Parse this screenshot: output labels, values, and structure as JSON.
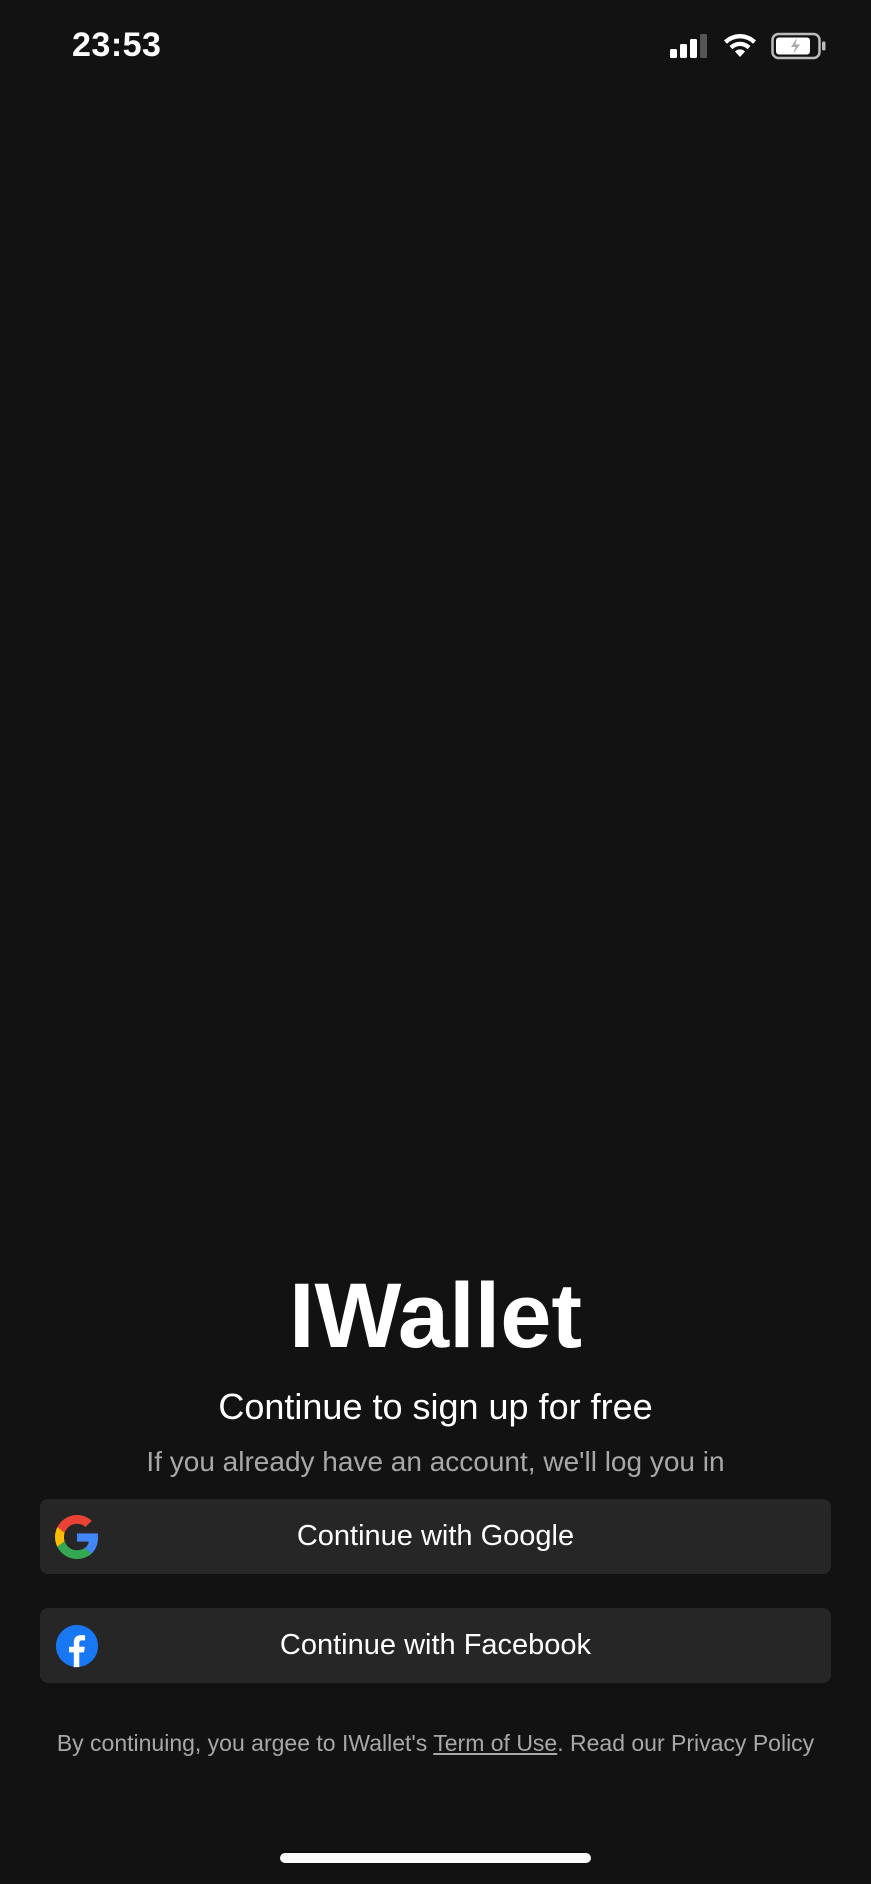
{
  "status_bar": {
    "time": "23:53"
  },
  "app": {
    "title": "IWallet"
  },
  "signup": {
    "headline": "Continue to sign up for free",
    "subheadline": "If you already have an account, we'll log you in"
  },
  "buttons": {
    "google_label": "Continue with Google",
    "facebook_label": "Continue with Facebook"
  },
  "legal": {
    "prefix": "By continuing, you argee to IWallet's ",
    "terms_link": "Term of Use",
    "middle": ". Read our ",
    "privacy_link": "Privacy Policy"
  },
  "icons": {
    "signal": "cellular-signal-icon",
    "wifi": "wifi-icon",
    "battery": "battery-charging-icon",
    "google": "google-logo-icon",
    "facebook": "facebook-logo-icon"
  },
  "colors": {
    "background": "#121212",
    "button_background": "#262626",
    "text_primary": "#ffffff",
    "text_secondary": "#a8a8a8",
    "google_blue": "#4285F4",
    "google_red": "#EA4335",
    "google_yellow": "#FBBC05",
    "google_green": "#34A853",
    "facebook_blue": "#1877F2"
  }
}
